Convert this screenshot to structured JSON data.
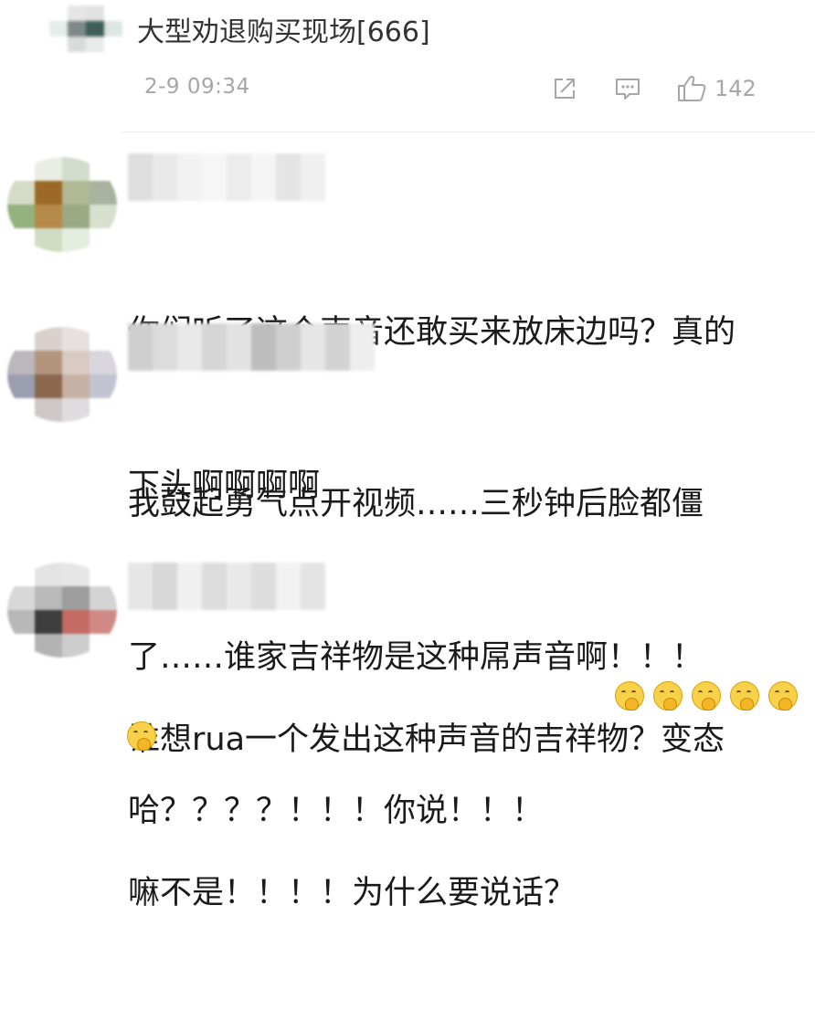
{
  "reply": {
    "text": "大型劝退购买现场[666]",
    "timestamp": "2-9 09:34",
    "like_count": "142",
    "avatar_colors": [
      "#ffffff",
      "#e6e6e6",
      "#e2e2e2",
      "#ffffff",
      "#e6ecea",
      "#7d8a88",
      "#3f5e57",
      "#dfe6e2",
      "#ffffff",
      "#d7dcda",
      "#e8ebea",
      "#ffffff"
    ]
  },
  "comments": [
    {
      "lines": [
        "你们听了这个声音还敢买来放床边吗？真的",
        "下头啊啊啊啊"
      ],
      "avatar_colors": [
        "#ffffff",
        "#e9ede6",
        "#d3dccc",
        "#ffffff",
        "#d6dbc7",
        "#9c6a26",
        "#b1b995",
        "#a8b29f",
        "#94b27e",
        "#b58a48",
        "#9aaa84",
        "#d7e0cf",
        "#ffffff",
        "#cfdcc2",
        "#e5ece0",
        "#ffffff"
      ],
      "username_colors": [
        "#dedede",
        "#e9e9e9",
        "#f2f2f2",
        "#f6f6f6",
        "#ececec",
        "#f5f5f5",
        "#e4e4e4",
        "#f0f0f0"
      ]
    },
    {
      "lines": [
        "我鼓起勇气点开视频……三秒钟后脸都僵",
        "了……谁家吉祥物是这种屌声音啊！！！",
        "哈？？？？！！！你说！！！"
      ],
      "avatar_colors": [
        "#ffffff",
        "#d9d1cd",
        "#e6e1de",
        "#ffffff",
        "#bcb6bd",
        "#b3957e",
        "#d9cbc3",
        "#d8d6dc",
        "#9b9db1",
        "#8b6750",
        "#c7b1a4",
        "#c2c4d2",
        "#ffffff",
        "#cfc7c6",
        "#dedcdf",
        "#ffffff"
      ],
      "username_colors": [
        "#cfcfcf",
        "#dcdcdc",
        "#e8e8e8",
        "#d6d6d6",
        "#e2e2e2",
        "#bdbdbd",
        "#cfcfcf",
        "#e6e6e6",
        "#d3d3d3",
        "#eeeeee"
      ]
    },
    {
      "lines": [
        "谁想rua一个发出这种声音的吉祥物？变态",
        "嘛不是！！！！为什么要说话？"
      ],
      "emojis": [
        "thinking-emoji",
        "thinking-emoji",
        "thinking-emoji",
        "thinking-emoji",
        "thinking-emoji",
        "thinking-emoji"
      ],
      "avatar_colors": [
        "#ffffff",
        "#e3e3e3",
        "#e6e6e6",
        "#ffffff",
        "#d8d8d8",
        "#b9b9b9",
        "#9d9d9d",
        "#d4d4d4",
        "#b8b8b8",
        "#3e3e3e",
        "#c46b63",
        "#cf8a85",
        "#ffffff",
        "#b3b3b3",
        "#cdcdcd",
        "#ffffff"
      ],
      "username_colors": [
        "#e6e6e6",
        "#d7d7d7",
        "#f0f0f0",
        "#dcdcdc",
        "#e9e9e9",
        "#dddddd",
        "#f2f2f2",
        "#e4e4e4"
      ]
    }
  ],
  "icons": {
    "share": "share-icon",
    "comment": "comment-icon",
    "like": "thumbs-up-icon"
  },
  "colors": {
    "meta_text": "#a6a6a6",
    "divider": "#ececec",
    "emoji_face": "#f7d14a"
  }
}
